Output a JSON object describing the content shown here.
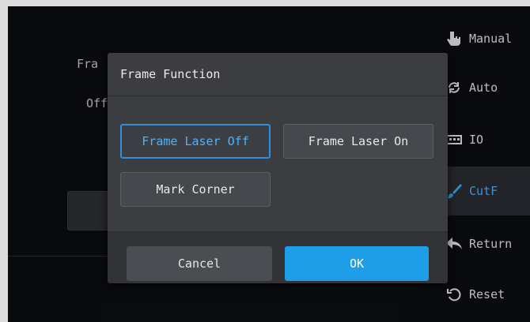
{
  "background": {
    "label_frame_partial": "Fra",
    "label_off_partial": "Off"
  },
  "sidebar": {
    "items": [
      {
        "label": "Manual",
        "icon": "hand-pointer-icon",
        "active": false
      },
      {
        "label": "Auto",
        "icon": "auto-cycle-icon",
        "active": false
      },
      {
        "label": "IO",
        "icon": "io-grid-icon",
        "active": false
      },
      {
        "label": "CutF",
        "icon": "brush-icon",
        "active": true
      },
      {
        "label": "Return",
        "icon": "return-arrow-icon",
        "active": false
      },
      {
        "label": "Reset",
        "icon": "reset-icon",
        "active": false
      }
    ]
  },
  "dialog": {
    "title": "Frame Function",
    "options": {
      "laser_off": "Frame Laser Off",
      "laser_on": "Frame Laser On",
      "mark_corner": "Mark Corner"
    },
    "selected_option": "Frame Laser Off",
    "cancel_label": "Cancel",
    "ok_label": "OK"
  },
  "colors": {
    "accent": "#1f9ee8",
    "selected_text": "#4db2ff",
    "dialog_bg": "#3b3d41",
    "screen_bg": "#0b0d10"
  }
}
